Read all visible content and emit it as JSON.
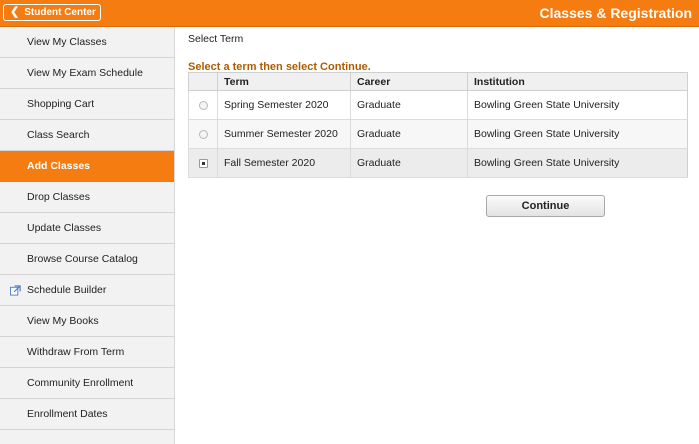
{
  "header": {
    "back_label": "Student Center",
    "title": "Classes & Registration",
    "accent_color": "#f47c10"
  },
  "sidebar": {
    "items": [
      {
        "label": "View My Classes",
        "active": false
      },
      {
        "label": "View My Exam Schedule",
        "active": false
      },
      {
        "label": "Shopping Cart",
        "active": false
      },
      {
        "label": "Class Search",
        "active": false
      },
      {
        "label": "Add Classes",
        "active": true
      },
      {
        "label": "Drop Classes",
        "active": false
      },
      {
        "label": "Update Classes",
        "active": false
      },
      {
        "label": "Browse Course Catalog",
        "active": false
      },
      {
        "label": "Schedule Builder",
        "active": false,
        "icon": "external-link-icon"
      },
      {
        "label": "View My Books",
        "active": false
      },
      {
        "label": "Withdraw From Term",
        "active": false
      },
      {
        "label": "Community Enrollment",
        "active": false
      },
      {
        "label": "Enrollment Dates",
        "active": false
      }
    ]
  },
  "main": {
    "section_label": "Select Term",
    "instruction": "Select a term then select Continue.",
    "table": {
      "headers": [
        "Term",
        "Career",
        "Institution"
      ],
      "rows": [
        {
          "term": "Spring Semester 2020",
          "career": "Graduate",
          "institution": "Bowling Green State University",
          "selected": false
        },
        {
          "term": "Summer Semester 2020",
          "career": "Graduate",
          "institution": "Bowling Green State University",
          "selected": false
        },
        {
          "term": "Fall Semester 2020",
          "career": "Graduate",
          "institution": "Bowling Green State University",
          "selected": true
        }
      ]
    },
    "continue_label": "Continue"
  }
}
